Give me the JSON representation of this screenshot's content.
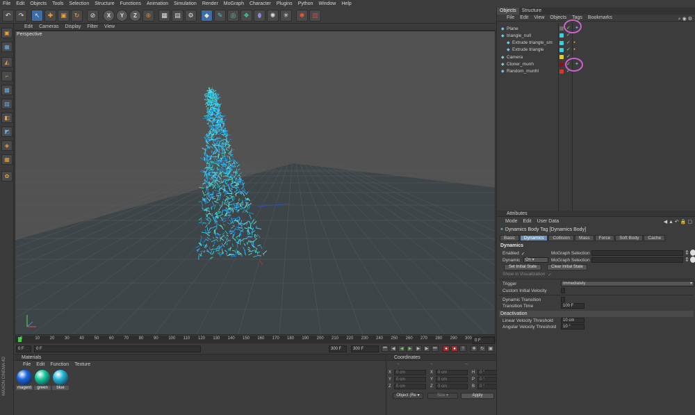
{
  "menubar": [
    "File",
    "Edit",
    "Objects",
    "Tools",
    "Selection",
    "Structure",
    "Functions",
    "Animation",
    "Simulation",
    "Render",
    "MoGraph",
    "Character",
    "Plugins",
    "Python",
    "Window",
    "Help"
  ],
  "toolbar": {
    "icons": [
      "undo-icon",
      "redo-icon",
      "select-icon",
      "move-icon",
      "scale-icon",
      "rotate-icon",
      "live-select-icon",
      "x-axis-icon",
      "y-axis-icon",
      "z-axis-icon",
      "world-coord-icon",
      "render-view-icon",
      "render-picture-icon",
      "render-settings-icon",
      "cube-icon",
      "spline-icon",
      "nurbs-icon",
      "array-icon",
      "deformer-icon",
      "scene-icon",
      "light-icon",
      "camera-icon",
      "python-icon"
    ],
    "axis_labels": [
      "X",
      "Y",
      "Z"
    ]
  },
  "viewport": {
    "menu": [
      "Edit",
      "Cameras",
      "Display",
      "Filter",
      "View"
    ],
    "label": "Perspective"
  },
  "timeline": {
    "ticks": [
      "0",
      "10",
      "20",
      "30",
      "40",
      "50",
      "60",
      "70",
      "80",
      "90",
      "100",
      "110",
      "120",
      "130",
      "140",
      "150",
      "160",
      "170",
      "180",
      "190",
      "200",
      "210",
      "220",
      "230",
      "240",
      "250",
      "260",
      "270",
      "280",
      "290",
      "300"
    ],
    "current_frame": "0 F",
    "start_field": "0 F",
    "min_field": "0 F",
    "end_field": "300 F",
    "max_field": "300 F"
  },
  "materials": {
    "title": "Materials",
    "menu": [
      "File",
      "Edit",
      "Function",
      "Texture"
    ],
    "items": [
      {
        "name": "magent",
        "color": "#1a66e0"
      },
      {
        "name": "green",
        "color": "#1ac79a"
      },
      {
        "name": "blue",
        "color": "#26b8d8"
      }
    ]
  },
  "coordinates": {
    "title": "Coordinates",
    "col_headers": [
      "--",
      "--",
      "--"
    ],
    "rows": [
      {
        "a": "X",
        "av": "0 cm",
        "b": "X",
        "bv": "0 cm",
        "c": "H",
        "cv": "0 °"
      },
      {
        "a": "Y",
        "av": "0 cm",
        "b": "Y",
        "bv": "0 cm",
        "c": "P",
        "cv": "0 °"
      },
      {
        "a": "Z",
        "av": "0 cm",
        "b": "Z",
        "bv": "0 cm",
        "c": "B",
        "cv": "0 °"
      }
    ],
    "mode_select": "Object (Re",
    "size_select": "Size",
    "apply": "Apply"
  },
  "objects": {
    "tabs": [
      "Objects",
      "Structure"
    ],
    "menu": [
      "File",
      "Edit",
      "View",
      "Objects",
      "Tags",
      "Bookmarks"
    ],
    "items": [
      {
        "name": "Plane",
        "color": "#6a6a6a",
        "indent": 0
      },
      {
        "name": "triangle_null",
        "color": "#3ad0e0",
        "indent": 0
      },
      {
        "name": "Extrude triangle_sm",
        "color": "#3ad0e0",
        "indent": 1
      },
      {
        "name": "Extrude triangle",
        "color": "#3ad0e0",
        "indent": 1
      },
      {
        "name": "Camera",
        "color": "#e0d020",
        "indent": 0
      },
      {
        "name": "Cloner_munh",
        "color": "#8a1020",
        "indent": 0
      },
      {
        "name": "Random_munhl",
        "color": "#e03030",
        "indent": 0
      }
    ]
  },
  "attributes": {
    "title": "Attributes",
    "menu": [
      "Mode",
      "Edit",
      "User Data"
    ],
    "object_title": "Dynamics Body Tag [Dynamics Body]",
    "tabs": [
      "Basic",
      "Dynamics",
      "Collision",
      "Mass",
      "Force",
      "Soft Body",
      "Cache"
    ],
    "active_tab": "Dynamics",
    "section": "Dynamics",
    "enabled_label": "Enabled",
    "enabled_check": "✓",
    "mograph_sel_label": "MoGraph Selection",
    "dynamic_label": "Dynamic",
    "dynamic_value": "On",
    "mograph_sel_label2": "MoGraph Selection",
    "set_initial": "Set Initial State",
    "clear_initial": "Clear Initial State",
    "show_vis": "Show in Visualization",
    "show_vis_check": "✓",
    "trigger_label": "Trigger",
    "trigger_value": "Immediately",
    "custom_vel": "Custom Initial Velocity",
    "dyn_transition": "Dynamic Transition",
    "transition_time_label": "Transition Time",
    "transition_time_value": "100 F",
    "deactivation": "Deactivation",
    "linear_label": "Linear Velocity Threshold",
    "linear_value": "10 cm",
    "angular_label": "Angular Velocity Threshold",
    "angular_value": "10 °"
  },
  "branding": "MAXON CINEMA 4D"
}
